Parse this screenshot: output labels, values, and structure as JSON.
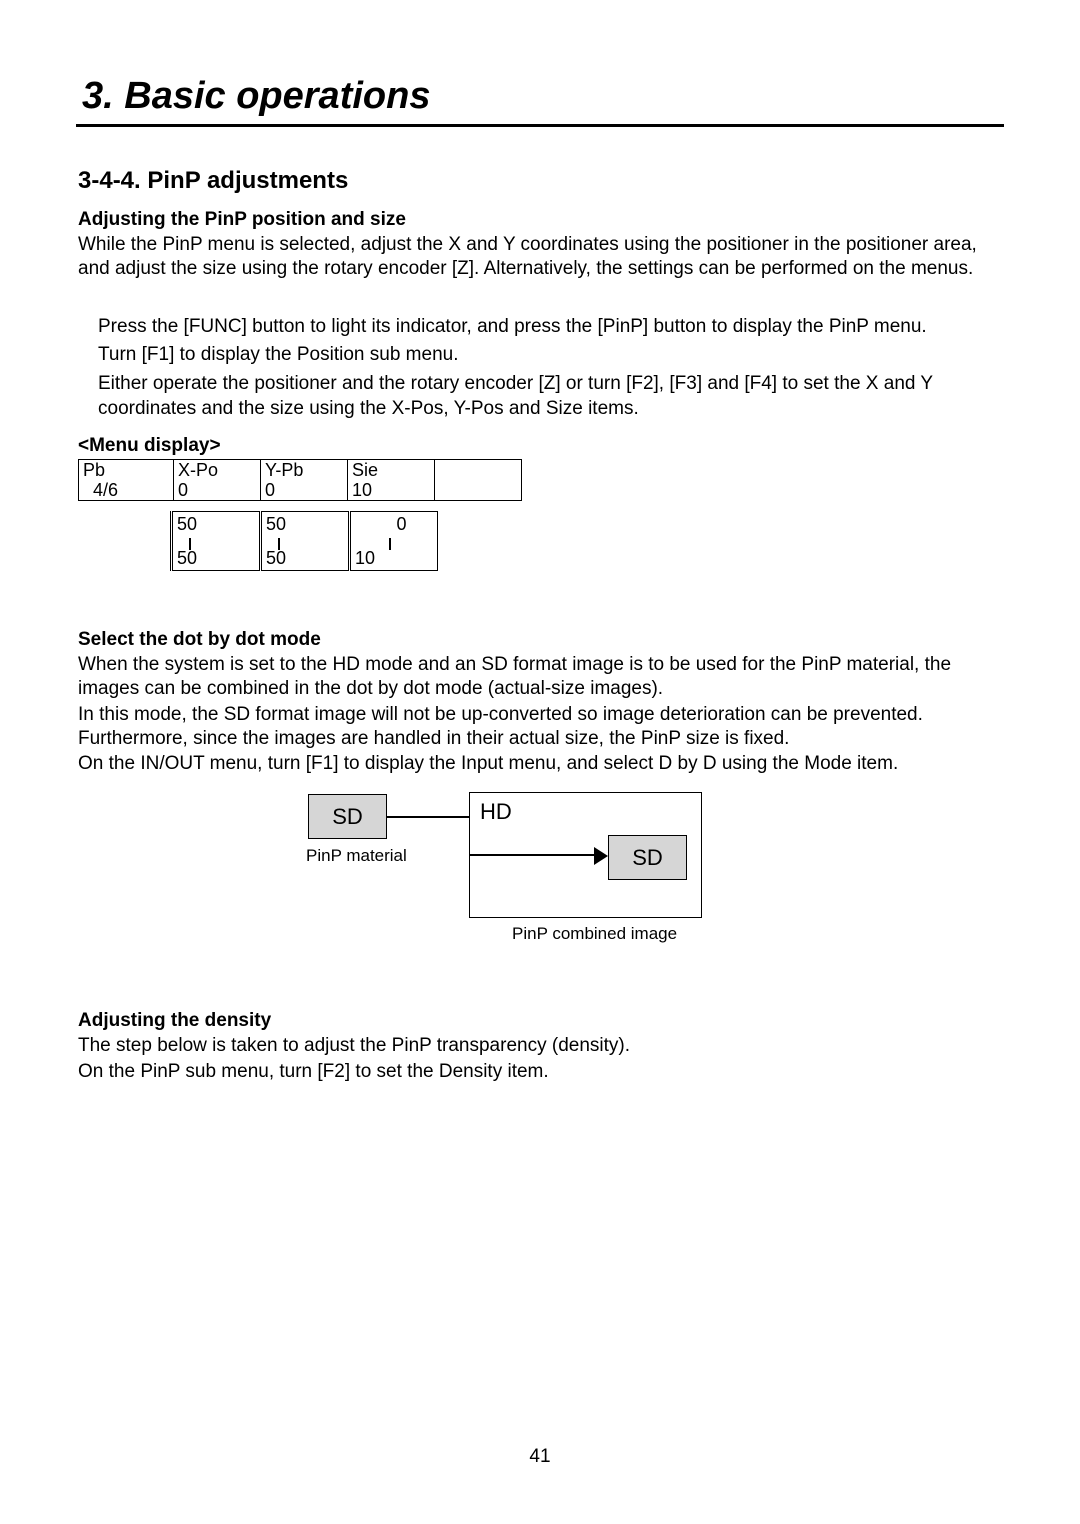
{
  "chapter_title": "3. Basic operations",
  "section_title": "3-4-4. PinP adjustments",
  "adjust_pos": {
    "heading": "Adjusting the PinP position and size",
    "p1": "While the PinP menu is selected, adjust the X and Y coordinates using the positioner in the positioner area, and adjust the size using the rotary encoder [Z]. Alternatively, the settings can be performed on the menus.",
    "step1": "Press the [FUNC] button to light its indicator, and press the [PinP] button to display the PinP menu.",
    "step2": "Turn [F1] to display the Position sub menu.",
    "step3": "Either operate the positioner and the rotary encoder [Z] or turn [F2], [F3] and [F4] to set the X and Y coordinates and the size using the X-Pos, Y-Pos and Size items."
  },
  "menu_display": {
    "label": "<Menu display>",
    "row1_col1_top": "Pb",
    "row1_col1_bot": "4/6",
    "headers": {
      "c2": "X-Po",
      "c3": "Y-Pb",
      "c4": "Sie"
    },
    "row2": {
      "c2": "0",
      "c3": "0",
      "c4": "10"
    },
    "limits": {
      "c2_top": "50",
      "c2_bot": "50",
      "c3_top": "50",
      "c3_bot": "50",
      "c4_top": "0",
      "c4_bot": "10"
    }
  },
  "dot_by_dot": {
    "heading": "Select the dot by dot mode",
    "p1": "When the system is set to the HD mode and an SD format image is to be used for the PinP material, the images can be combined in the dot by dot mode (actual-size images).",
    "p2": "In this mode, the SD format image will not be up-converted so image deterioration can be prevented. Furthermore, since the images are handled in their actual size, the PinP size is fixed.",
    "p3": "On the IN/OUT menu, turn [F1] to display the Input menu, and select D by D using the Mode item.",
    "sd": "SD",
    "hd": "HD",
    "sd_inner": "SD",
    "mat_label": "PinP material",
    "comb_label": "PinP combined image"
  },
  "density": {
    "heading": "Adjusting the density",
    "p1": "The step below is taken to adjust the PinP transparency (density).",
    "p2": "On the PinP sub menu, turn [F2] to set the Density item."
  },
  "page_number": "41"
}
